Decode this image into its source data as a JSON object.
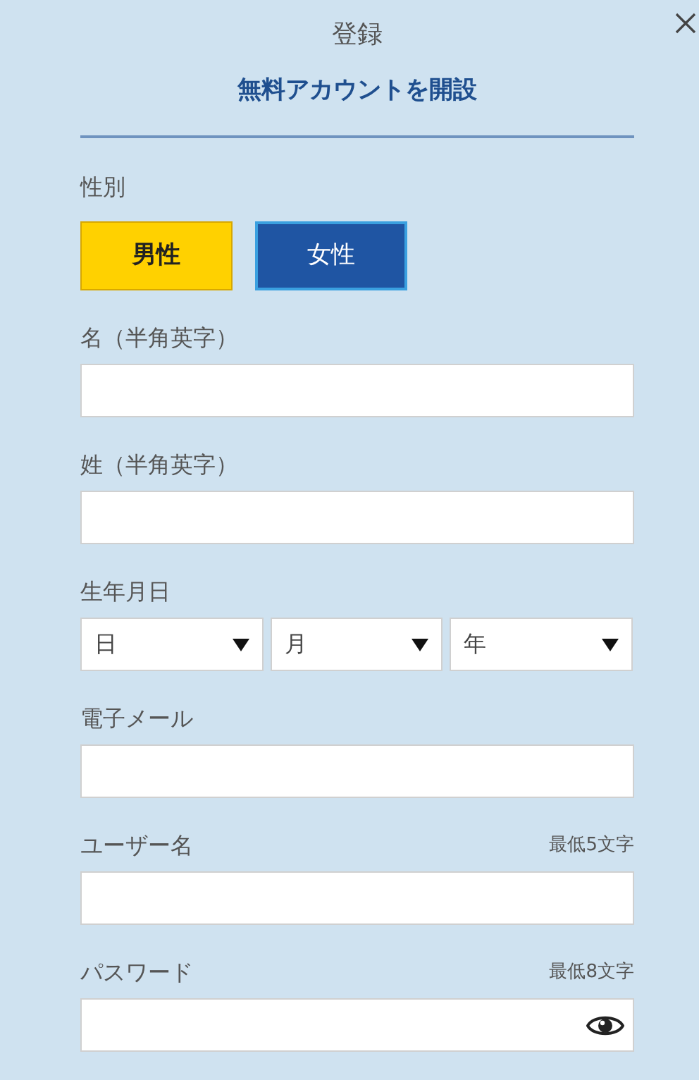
{
  "title": "登録",
  "subtitle": "無料アカウントを開設",
  "gender": {
    "label": "性別",
    "options": [
      {
        "label": "男性",
        "selected": true
      },
      {
        "label": "女性",
        "selected": false
      }
    ]
  },
  "fields": [
    {
      "kind": "text",
      "label": "名（半角英字）"
    },
    {
      "kind": "text",
      "label": "姓（半角英字）"
    },
    {
      "kind": "date",
      "label": "生年月日",
      "selects": [
        "日",
        "月",
        "年"
      ]
    },
    {
      "kind": "text",
      "label": "電子メール"
    },
    {
      "kind": "text",
      "label": "ユーザー名",
      "hint": "最低5文字"
    },
    {
      "kind": "password",
      "label": "パスワード",
      "hint": "最低8文字"
    }
  ]
}
